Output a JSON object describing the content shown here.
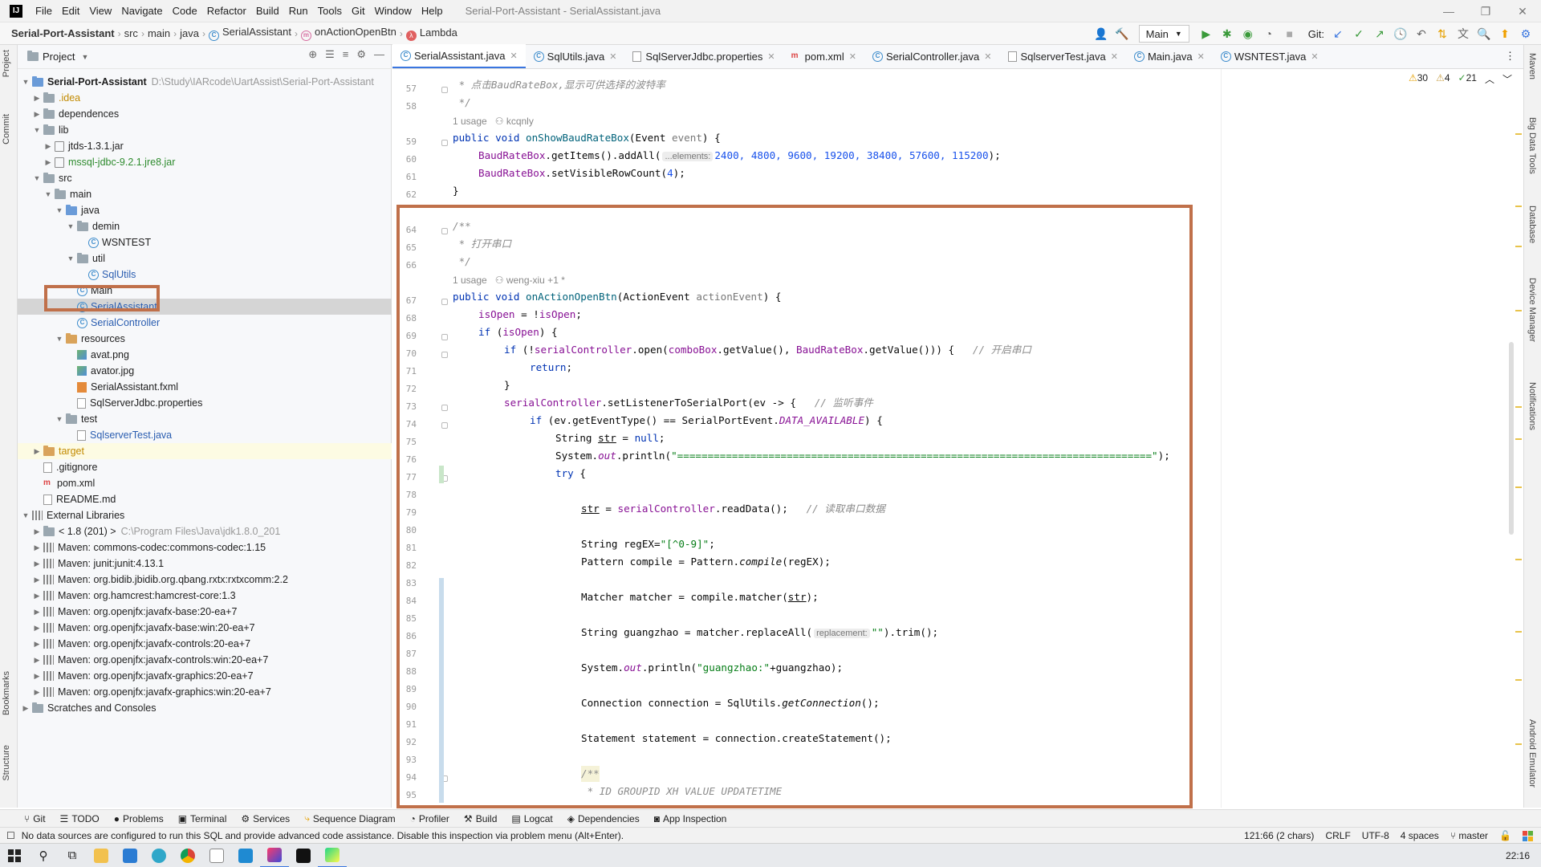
{
  "menubar": {
    "logo": "IJ",
    "items": [
      "File",
      "Edit",
      "View",
      "Navigate",
      "Code",
      "Refactor",
      "Build",
      "Run",
      "Tools",
      "Git",
      "Window",
      "Help"
    ],
    "title": "Serial-Port-Assistant - SerialAssistant.java"
  },
  "window_controls": [
    "—",
    "❐",
    "✕"
  ],
  "breadcrumb": [
    "Serial-Port-Assistant",
    "src",
    "main",
    "java",
    "SerialAssistant",
    "onActionOpenBtn",
    "Lambda"
  ],
  "toolbar": {
    "run_config": "Main",
    "git_label": "Git:"
  },
  "left_strip": [
    "Project",
    "Commit",
    "Bookmarks",
    "Structure"
  ],
  "right_strip": [
    "Maven",
    "Big Data Tools",
    "Database",
    "Device Manager",
    "Notifications",
    "Android Emulator"
  ],
  "project_panel": {
    "title": "Project",
    "tree": [
      {
        "label": "Serial-Port-Assistant",
        "extra": "D:\\Study\\IARcode\\UartAssist\\Serial-Port-Assistant"
      },
      {
        "label": ".idea"
      },
      {
        "label": "dependences"
      },
      {
        "label": "lib"
      },
      {
        "label": "jtds-1.3.1.jar"
      },
      {
        "label": "mssql-jdbc-9.2.1.jre8.jar"
      },
      {
        "label": "src"
      },
      {
        "label": "main"
      },
      {
        "label": "java"
      },
      {
        "label": "demin"
      },
      {
        "label": "WSNTEST"
      },
      {
        "label": "util"
      },
      {
        "label": "SqlUtils"
      },
      {
        "label": "Main"
      },
      {
        "label": "SerialAssistant"
      },
      {
        "label": "SerialController"
      },
      {
        "label": "resources"
      },
      {
        "label": "avat.png"
      },
      {
        "label": "avator.jpg"
      },
      {
        "label": "SerialAssistant.fxml"
      },
      {
        "label": "SqlServerJdbc.properties"
      },
      {
        "label": "test"
      },
      {
        "label": "SqlserverTest.java"
      },
      {
        "label": "target"
      },
      {
        "label": ".gitignore"
      },
      {
        "label": "pom.xml"
      },
      {
        "label": "README.md"
      },
      {
        "label": "External Libraries"
      },
      {
        "label": "< 1.8 (201) >",
        "extra": "C:\\Program Files\\Java\\jdk1.8.0_201"
      },
      {
        "label": "Maven: commons-codec:commons-codec:1.15"
      },
      {
        "label": "Maven: junit:junit:4.13.1"
      },
      {
        "label": "Maven: org.bidib.jbidib.org.qbang.rxtx:rxtxcomm:2.2"
      },
      {
        "label": "Maven: org.hamcrest:hamcrest-core:1.3"
      },
      {
        "label": "Maven: org.openjfx:javafx-base:20-ea+7"
      },
      {
        "label": "Maven: org.openjfx:javafx-base:win:20-ea+7"
      },
      {
        "label": "Maven: org.openjfx:javafx-controls:20-ea+7"
      },
      {
        "label": "Maven: org.openjfx:javafx-controls:win:20-ea+7"
      },
      {
        "label": "Maven: org.openjfx:javafx-graphics:20-ea+7"
      },
      {
        "label": "Maven: org.openjfx:javafx-graphics:win:20-ea+7"
      },
      {
        "label": "Scratches and Consoles"
      }
    ]
  },
  "editor": {
    "tabs": [
      "SerialAssistant.java",
      "SqlUtils.java",
      "SqlServerJdbc.properties",
      "pom.xml",
      "SerialController.java",
      "SqlserverTest.java",
      "Main.java",
      "WSNTEST.java"
    ],
    "inspections": {
      "warnings": "30",
      "weak": "4",
      "ok": "21"
    },
    "line_numbers": [
      "57",
      "58",
      "59",
      "60",
      "61",
      "62",
      "64",
      "65",
      "66",
      "67",
      "68",
      "69",
      "70",
      "71",
      "72",
      "73",
      "74",
      "75",
      "76",
      "77",
      "78",
      "79",
      "80",
      "81",
      "82",
      "83",
      "84",
      "85",
      "86",
      "87",
      "88",
      "89",
      "90",
      "91",
      "92",
      "93",
      "94",
      "95"
    ],
    "meta": {
      "usage1": "1 usage",
      "author1": "kcqnly",
      "usage2": "1 usage",
      "author2": "weng-xiu +1 *"
    },
    "code": {
      "l57": " * 点击BaudRateBox,显示可供选择的波特率",
      "l58": " */",
      "l59_kw": "public void ",
      "l59_fn": "onShowBaudRateBox",
      "l59_a": "(Event ",
      "l59_p": "event",
      "l59_b": ") {",
      "l60_f": "BaudRateBox",
      "l60_a": ".getItems().addAll(",
      "l60_hint": "...elements:",
      "l60_nums": "2400, 4800, 9600, 19200, 38400, 57600, 115200",
      "l60_b": ");",
      "l61_f": "BaudRateBox",
      "l61_a": ".setVisibleRowCount(",
      "l61_n": "4",
      "l61_b": ");",
      "l62": "}",
      "l64": "/**",
      "l65": " * 打开串口",
      "l66": " */",
      "l67_kw": "public void ",
      "l67_fn": "onActionOpenBtn",
      "l67_a": "(ActionEvent ",
      "l67_p": "actionEvent",
      "l67_b": ") {",
      "l68_f1": "isOpen",
      "l68_a": " = !",
      "l68_f2": "isOpen",
      "l68_b": ";",
      "l69_kw": "if ",
      "l69_a": "(",
      "l69_f": "isOpen",
      "l69_b": ") {",
      "l70_kw": "if ",
      "l70_a": "(!",
      "l70_f1": "serialController",
      "l70_b": ".open(",
      "l70_f2": "comboBox",
      "l70_c": ".getValue(), ",
      "l70_f3": "BaudRateBox",
      "l70_d": ".getValue())) {   ",
      "l70_cm": "// 开启串口",
      "l71_kw": "return",
      "l71_b": ";",
      "l72": "}",
      "l73_f": "serialController",
      "l73_a": ".setListenerToSerialPort(ev -> {   ",
      "l73_cm": "// 监听事件",
      "l74_kw": "if ",
      "l74_a": "(ev.getEventType() == SerialPortEvent.",
      "l74_f": "DATA_AVAILABLE",
      "l74_b": ") {",
      "l75_a": "String ",
      "l75_u": "str",
      "l75_b": " = ",
      "l75_kw": "null",
      "l75_c": ";",
      "l76_a": "System.",
      "l76_f": "out",
      "l76_b": ".println(",
      "l76_s": "\"==============================================================================\"",
      "l76_c": ");",
      "l77_kw": "try",
      "l77_b": " {",
      "l79_u": "str",
      "l79_a": " = ",
      "l79_f": "serialController",
      "l79_b": ".readData();   ",
      "l79_cm": "// 读取串口数据",
      "l81_a": "String regEX=",
      "l81_s": "\"[^0-9]\"",
      "l81_b": ";",
      "l82_a": "Pattern compile = Pattern.",
      "l82_i": "compile",
      "l82_b": "(regEX);",
      "l84_a": "Matcher matcher = compile.matcher(",
      "l84_u": "str",
      "l84_b": ");",
      "l86_a": "String guangzhao = matcher.replaceAll(",
      "l86_hint": "replacement:",
      "l86_s": "\"\"",
      "l86_b": ").trim();",
      "l88_a": "System.",
      "l88_f": "out",
      "l88_b": ".println(",
      "l88_s": "\"guangzhao:\"",
      "l88_c": "+guangzhao);",
      "l90_a": "Connection connection = SqlUtils.",
      "l90_i": "getConnection",
      "l90_b": "();",
      "l92": "Statement statement = connection.createStatement();",
      "l94": "/**",
      "l95": " * ID GROUPID XH VALUE UPDATETIME"
    }
  },
  "bottom_tools": [
    "Git",
    "TODO",
    "Problems",
    "Terminal",
    "Services",
    "Sequence Diagram",
    "Profiler",
    "Build",
    "Logcat",
    "Dependencies",
    "App Inspection"
  ],
  "status": {
    "message": "No data sources are configured to run this SQL and provide advanced code assistance. Disable this inspection via problem menu (Alt+Enter).",
    "position": "121:66 (2 chars)",
    "line_sep": "CRLF",
    "encoding": "UTF-8",
    "indent": "4 spaces",
    "branch": "master"
  },
  "taskbar": {
    "time": "22:16"
  },
  "colors": {
    "highlight_box": "#c0704a",
    "keyword": "#0033b3",
    "string": "#067d17",
    "field": "#871094",
    "number": "#1750eb"
  }
}
